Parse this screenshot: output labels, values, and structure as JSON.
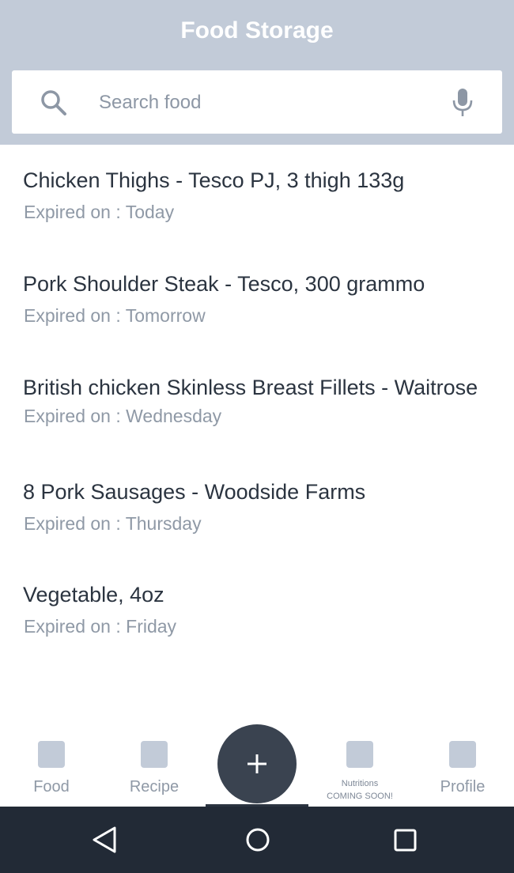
{
  "header": {
    "title": "Food Storage"
  },
  "search": {
    "placeholder": "Search food",
    "value": "",
    "icon": "search-icon",
    "mic_icon": "microphone-icon"
  },
  "food_items": [
    {
      "name": "Chicken Thighs - Tesco PJ, 3 thigh 133g",
      "expiry_prefix": "Expired on : ",
      "expiry_day": "Today"
    },
    {
      "name": "Pork Shoulder Steak - Tesco, 300 grammo",
      "expiry_prefix": "Expired on : ",
      "expiry_day": "Tomorrow"
    },
    {
      "name": "British chicken Skinless Breast Fillets - Waitrose",
      "expiry_prefix": "Expired on : ",
      "expiry_day": "Wednesday"
    },
    {
      "name": "8 Pork Sausages - Woodside Farms",
      "expiry_prefix": "Expired on : ",
      "expiry_day": "Thursday"
    },
    {
      "name": "Vegetable, 4oz",
      "expiry_prefix": "Expired on : ",
      "expiry_day": "Friday"
    }
  ],
  "bottom_nav": {
    "food_label": "Food",
    "recipe_label": "Recipe",
    "add_icon": "plus-icon",
    "nutritions_label": "Nutritions",
    "nutritions_sublabel": "COMING SOON!",
    "profile_label": "Profile"
  },
  "system_nav": {
    "back_icon": "back-triangle-icon",
    "home_icon": "home-circle-icon",
    "recents_icon": "recents-square-icon"
  },
  "colors": {
    "header_bg": "#c2cbd8",
    "fab_bg": "#3a4350",
    "system_bar_bg": "#222a36",
    "text_primary": "#2b3440",
    "text_secondary": "#8f99a6"
  }
}
